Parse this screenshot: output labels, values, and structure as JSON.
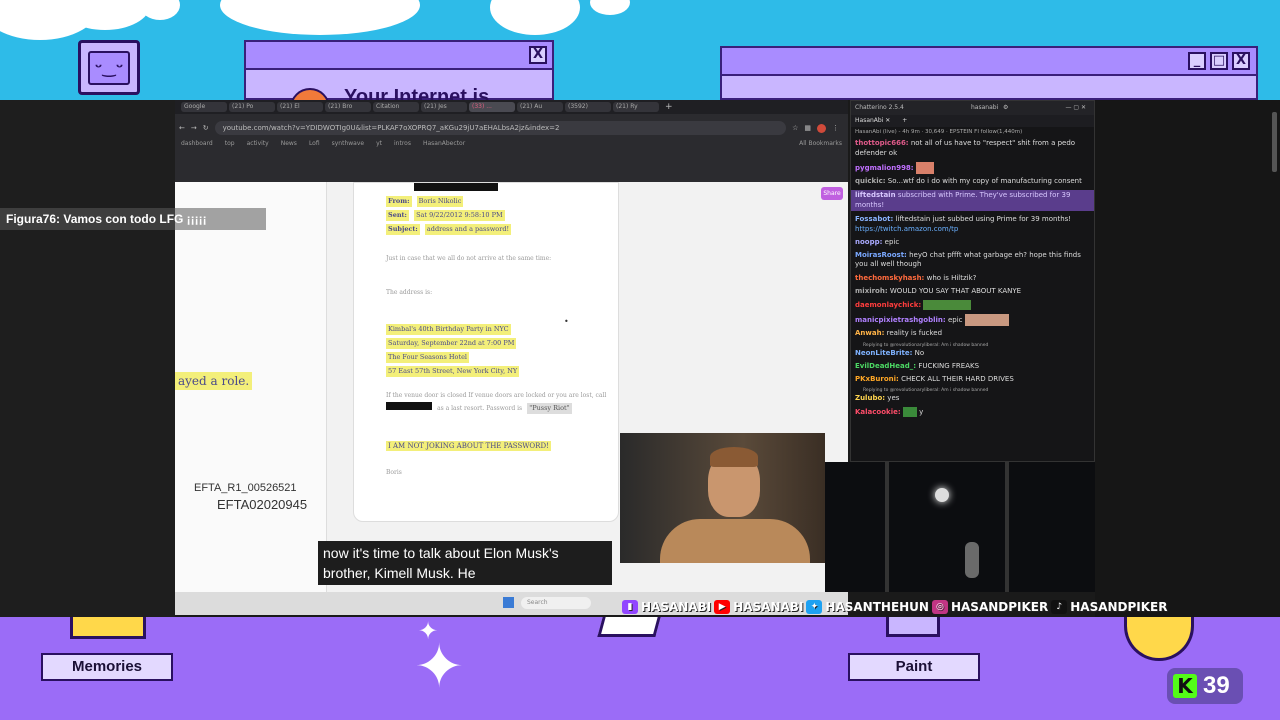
{
  "overlay_top": {
    "window_title": "Your Internet is",
    "window_close": "X",
    "window2_min": "_",
    "window2_max": "□",
    "window2_close": "X"
  },
  "browser": {
    "tabs": [
      "Google",
      "(21) Po",
      "(21) El",
      "(21) Bro",
      "Citation",
      "(21) Jes",
      "(33) ...",
      "(21) Au",
      "(3592)",
      "(21) Ry"
    ],
    "new_tab": "+",
    "url": "youtube.com/watch?v=YDIDWOTIg0U&list=PLKAF7oXOPRQ7_aKGu29jU7aEHALbsA2jz&index=2",
    "bookmarks": [
      "dashboard",
      "top",
      "activity",
      "News",
      "Lofi",
      "synthwave",
      "yt",
      "intros",
      "HasanAbector"
    ],
    "all_bookmarks": "All Bookmarks",
    "share": "Share"
  },
  "document": {
    "from_label": "From:",
    "from_value": "Boris Nikolic",
    "sent_label": "Sent:",
    "sent_value": "Sat 9/22/2012 9:58:10 PM",
    "subject_label": "Subject:",
    "subject_value": "address and a password!",
    "line1": "Just in case that we all do not arrive at the same time:",
    "line2": "The address is:",
    "address": [
      "Kimbal's 40th Birthday Party in NYC",
      "Saturday, September 22nd at 7:00 PM",
      "The Four Seasons Hotel",
      "57 East 57th Street, New York City, NY"
    ],
    "venue_text": "If the venue door is closed If venue doors are locked or you are lost, call",
    "venue_text2": "as a last resort. Password is",
    "password": "\"Pussy Riot\"",
    "not_joking": "I AM NOT JOKING ABOUT THE PASSWORD!",
    "signoff": "Boris",
    "left_fragment": "ayed a role.",
    "bates1": "EFTA_R1_00526521",
    "bates2": "EFTA02020945"
  },
  "chat_panel": {
    "app_title": "Chatterino 2.5.4",
    "account": "hasanabi",
    "channel_tab": "HasanAbi",
    "status": "HasanAbi (live) - 4h 9m · 30,649 · EPSTEIN FI  follow(1,440m)",
    "messages": [
      {
        "user": "thottopic666:",
        "text": "not all of us have to \"respect\" shit from a pedo defender ok",
        "color": "#e05a8a"
      },
      {
        "user": "pygmalion998:",
        "text": "",
        "color": "#c070ff"
      },
      {
        "user": "quickic:",
        "text": "So...wtf do i do with my copy of manufacturing consent",
        "color": "#aaaaaa"
      },
      {
        "user": "liftedstain",
        "text": "subscribed with Prime. They've subscribed for 39 months!",
        "color": "#b08cff"
      },
      {
        "user": "Fossabot:",
        "text": "liftedstain just subbed using Prime for 39 months!",
        "link": "https://twitch.amazon.com/tp",
        "color": "#8ab4ff"
      },
      {
        "user": "noopp:",
        "text": "epic",
        "color": "#aaaaff"
      },
      {
        "user": "MoirasRoost:",
        "text": "heyO chat   pffft what garbage eh? hope this finds you all well though",
        "color": "#7aa8ff"
      },
      {
        "user": "thechomskyhash:",
        "text": "who is Hiltzik?",
        "color": "#ff6a3d"
      },
      {
        "user": "mixiroh:",
        "text": "WOULD YOU SAY THAT ABOUT KANYE",
        "color": "#aaaaaa"
      },
      {
        "user": "daemonlaychick:",
        "text": "",
        "color": "#ff3d3d"
      },
      {
        "user": "manicpixietrashgoblin:",
        "text": "epic",
        "color": "#b080ff"
      },
      {
        "user": "Anwah:",
        "text": "reality is fucked",
        "color": "#ffb347"
      },
      {
        "user": "NeonLiteBrite:",
        "text": "No",
        "color": "#7fb2ff",
        "reply": "Replying to @revolutionaryliberal: Am i shadow banned"
      },
      {
        "user": "EvilDeadHead_:",
        "text": "FUCKING FREAKS",
        "color": "#4cd964"
      },
      {
        "user": "PKxBuroni:",
        "text": "CHECK ALL THEIR HARD DRIVES",
        "color": "#ffa726"
      },
      {
        "user": "Zulubo:",
        "text": "yes",
        "color": "#ffd54f",
        "reply": "Replying to @revolutionaryliberal: Am i shadow banned"
      },
      {
        "user": "Kalacookie:",
        "text": "y",
        "color": "#ff4d6a"
      }
    ]
  },
  "subtitle": {
    "line1": "now it's time to talk about Elon Musk's",
    "line2": "brother, Kimell Musk. He"
  },
  "chat_overlay": {
    "user": "Figura76",
    "text": ": Vamos con todo LFG ¡¡¡¡¡"
  },
  "taskbar": {
    "search": "Search"
  },
  "socials": [
    {
      "icon": "twitch-icon",
      "label": "HASANABI",
      "color": "#9146ff",
      "glyph": "▮"
    },
    {
      "icon": "youtube-icon",
      "label": "HASANABI",
      "color": "#ff0000",
      "glyph": "▶"
    },
    {
      "icon": "twitter-icon",
      "label": "HASANTHEHUN",
      "color": "#1da1f2",
      "glyph": "✦"
    },
    {
      "icon": "instagram-icon",
      "label": "HASANDPIKER",
      "color": "#c13584",
      "glyph": "◎"
    },
    {
      "icon": "tiktok-icon",
      "label": "HASANDPIKER",
      "color": "#111111",
      "glyph": "♪"
    }
  ],
  "desktop": {
    "memories": "Memories",
    "paint": "Paint"
  },
  "kick": {
    "logo": "K",
    "viewers": "39"
  }
}
